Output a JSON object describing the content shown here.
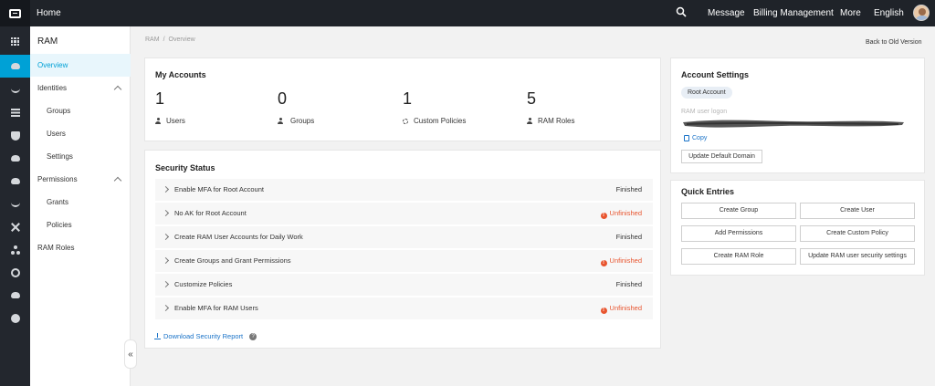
{
  "topbar": {
    "home": "Home",
    "nav": [
      "Message",
      "Billing Management",
      "More",
      "English"
    ]
  },
  "sidebar": {
    "title": "RAM",
    "items": [
      {
        "label": "Overview"
      },
      {
        "label": "Identities"
      },
      {
        "label": "Groups"
      },
      {
        "label": "Users"
      },
      {
        "label": "Settings"
      },
      {
        "label": "Permissions"
      },
      {
        "label": "Grants"
      },
      {
        "label": "Policies"
      },
      {
        "label": "RAM Roles"
      }
    ],
    "collapse_glyph": "«"
  },
  "breadcrumb": {
    "root": "RAM",
    "separator": "/",
    "current": "Overview"
  },
  "back_link": "Back to Old Version",
  "accounts": {
    "title": "My Accounts",
    "stats": [
      {
        "value": "1",
        "label": "Users",
        "icon": "user-icon"
      },
      {
        "value": "0",
        "label": "Groups",
        "icon": "group-icon"
      },
      {
        "value": "1",
        "label": "Custom Policies",
        "icon": "gear-icon"
      },
      {
        "value": "5",
        "label": "RAM Roles",
        "icon": "role-icon"
      }
    ]
  },
  "security": {
    "title": "Security Status",
    "rows": [
      {
        "label": "Enable MFA for Root Account",
        "status": "Finished",
        "ok": true
      },
      {
        "label": "No AK for Root Account",
        "status": "Unfinished",
        "ok": false
      },
      {
        "label": "Create RAM User Accounts for Daily Work",
        "status": "Finished",
        "ok": true
      },
      {
        "label": "Create Groups and Grant Permissions",
        "status": "Unfinished",
        "ok": false
      },
      {
        "label": "Customize Policies",
        "status": "Finished",
        "ok": true
      },
      {
        "label": "Enable MFA for RAM Users",
        "status": "Unfinished",
        "ok": false
      }
    ],
    "download": "Download Security Report",
    "help_glyph": "?",
    "warn_glyph": "!"
  },
  "account_settings": {
    "title": "Account Settings",
    "badge": "Root Account",
    "logon_label": "RAM user logon",
    "copy": "Copy",
    "update_button": "Update Default Domain"
  },
  "quick_entries": {
    "title": "Quick Entries",
    "buttons": [
      "Create Group",
      "Create User",
      "Add Permissions",
      "Create Custom Policy",
      "Create RAM Role",
      "Update RAM user security settings"
    ]
  },
  "colors": {
    "accent": "#00a1d6",
    "topbar": "#1f2329",
    "error": "#e8542e",
    "link": "#1a73c8"
  }
}
